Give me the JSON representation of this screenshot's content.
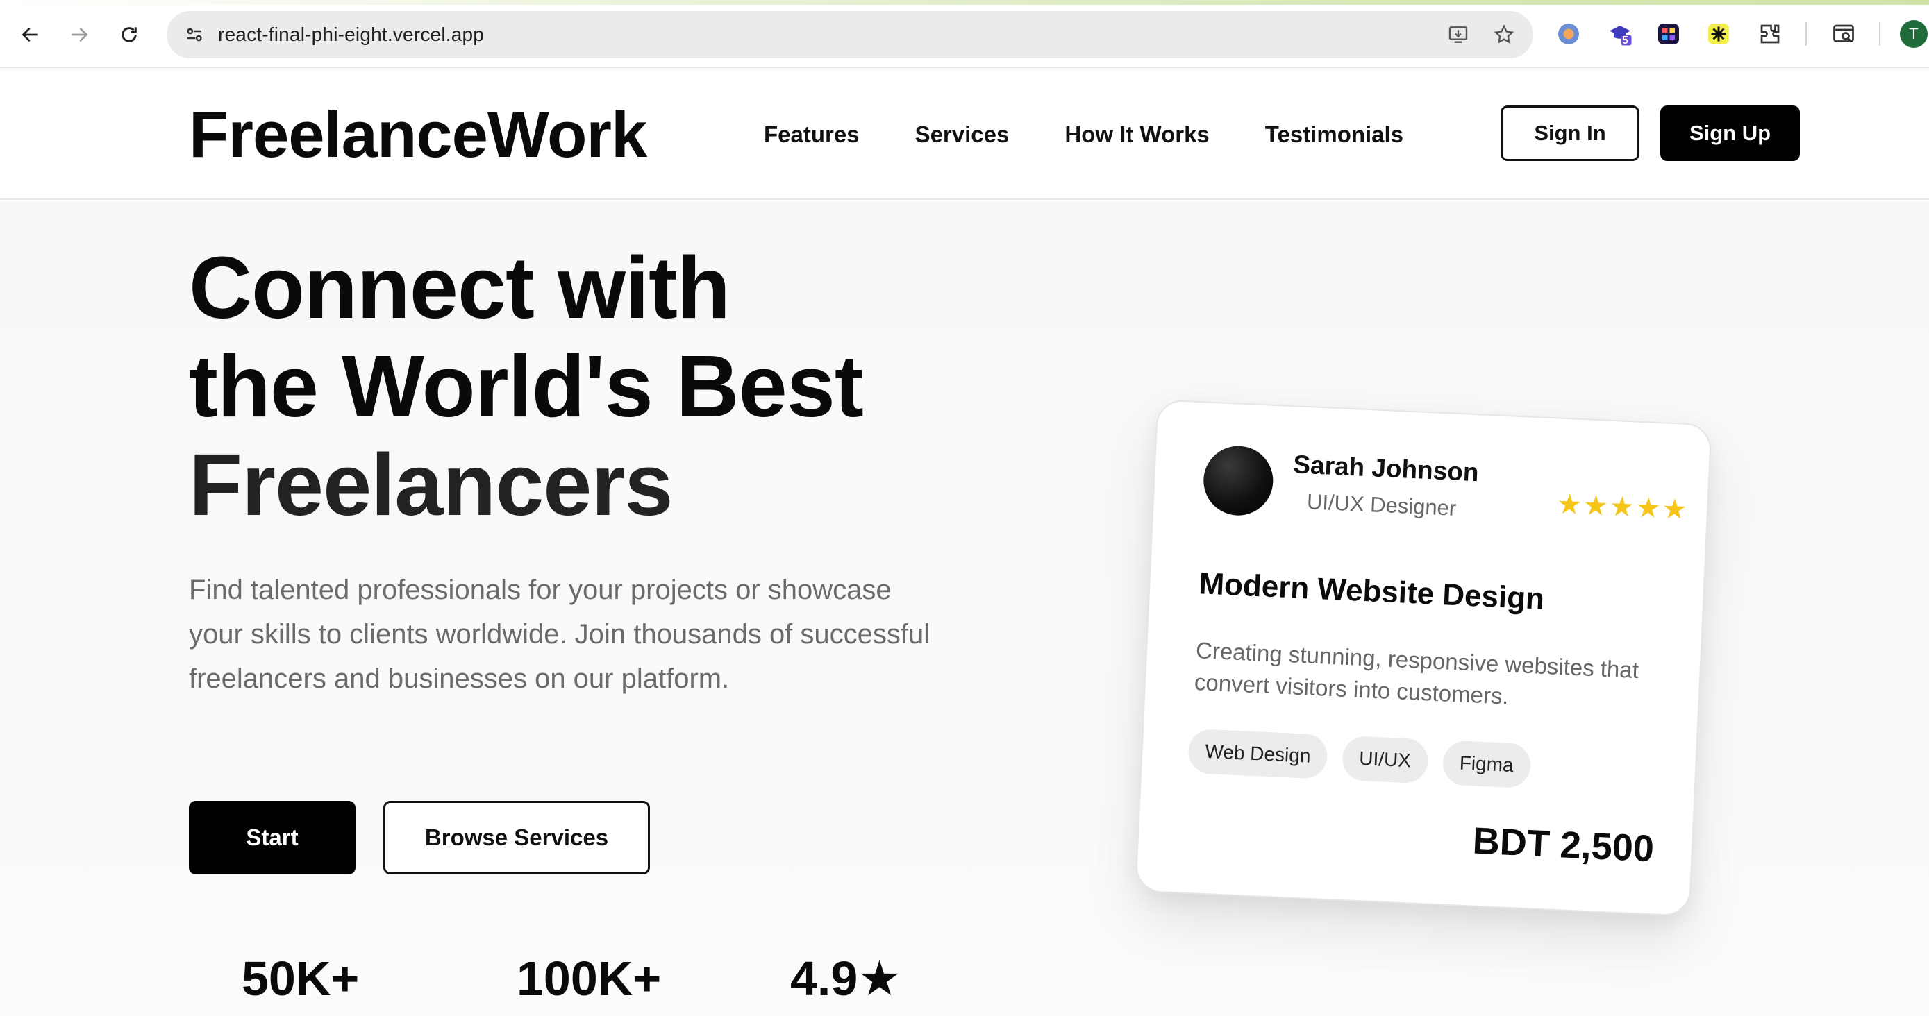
{
  "browser": {
    "url": "react-final-phi-eight.vercel.app",
    "extension_badge": "5",
    "profile_initial": "T"
  },
  "header": {
    "logo": "FreelanceWork",
    "nav": [
      "Features",
      "Services",
      "How It Works",
      "Testimonials"
    ],
    "sign_in": "Sign In",
    "sign_up": "Sign Up"
  },
  "hero": {
    "title_line1": "Connect with",
    "title_line2": "the World's Best",
    "title_line3": "Freelancers",
    "subtitle": "Find talented professionals for your projects or showcase your skills to clients worldwide. Join thousands of successful freelancers and businesses on our platform.",
    "start_label": "Start",
    "browse_label": "Browse Services",
    "stats": [
      "50K+",
      "100K+",
      "4.9★"
    ]
  },
  "card": {
    "name": "Sarah Johnson",
    "role": "UI/UX Designer",
    "stars": "★★★★★",
    "title": "Modern Website Design",
    "description": "Creating stunning, responsive websites that convert visitors into customers.",
    "tags": [
      "Web Design",
      "UI/UX",
      "Figma"
    ],
    "price": "BDT 2,500"
  },
  "colors": {
    "accent": "#000000",
    "star": "#f5c518",
    "muted_text": "#6b6b6b"
  }
}
